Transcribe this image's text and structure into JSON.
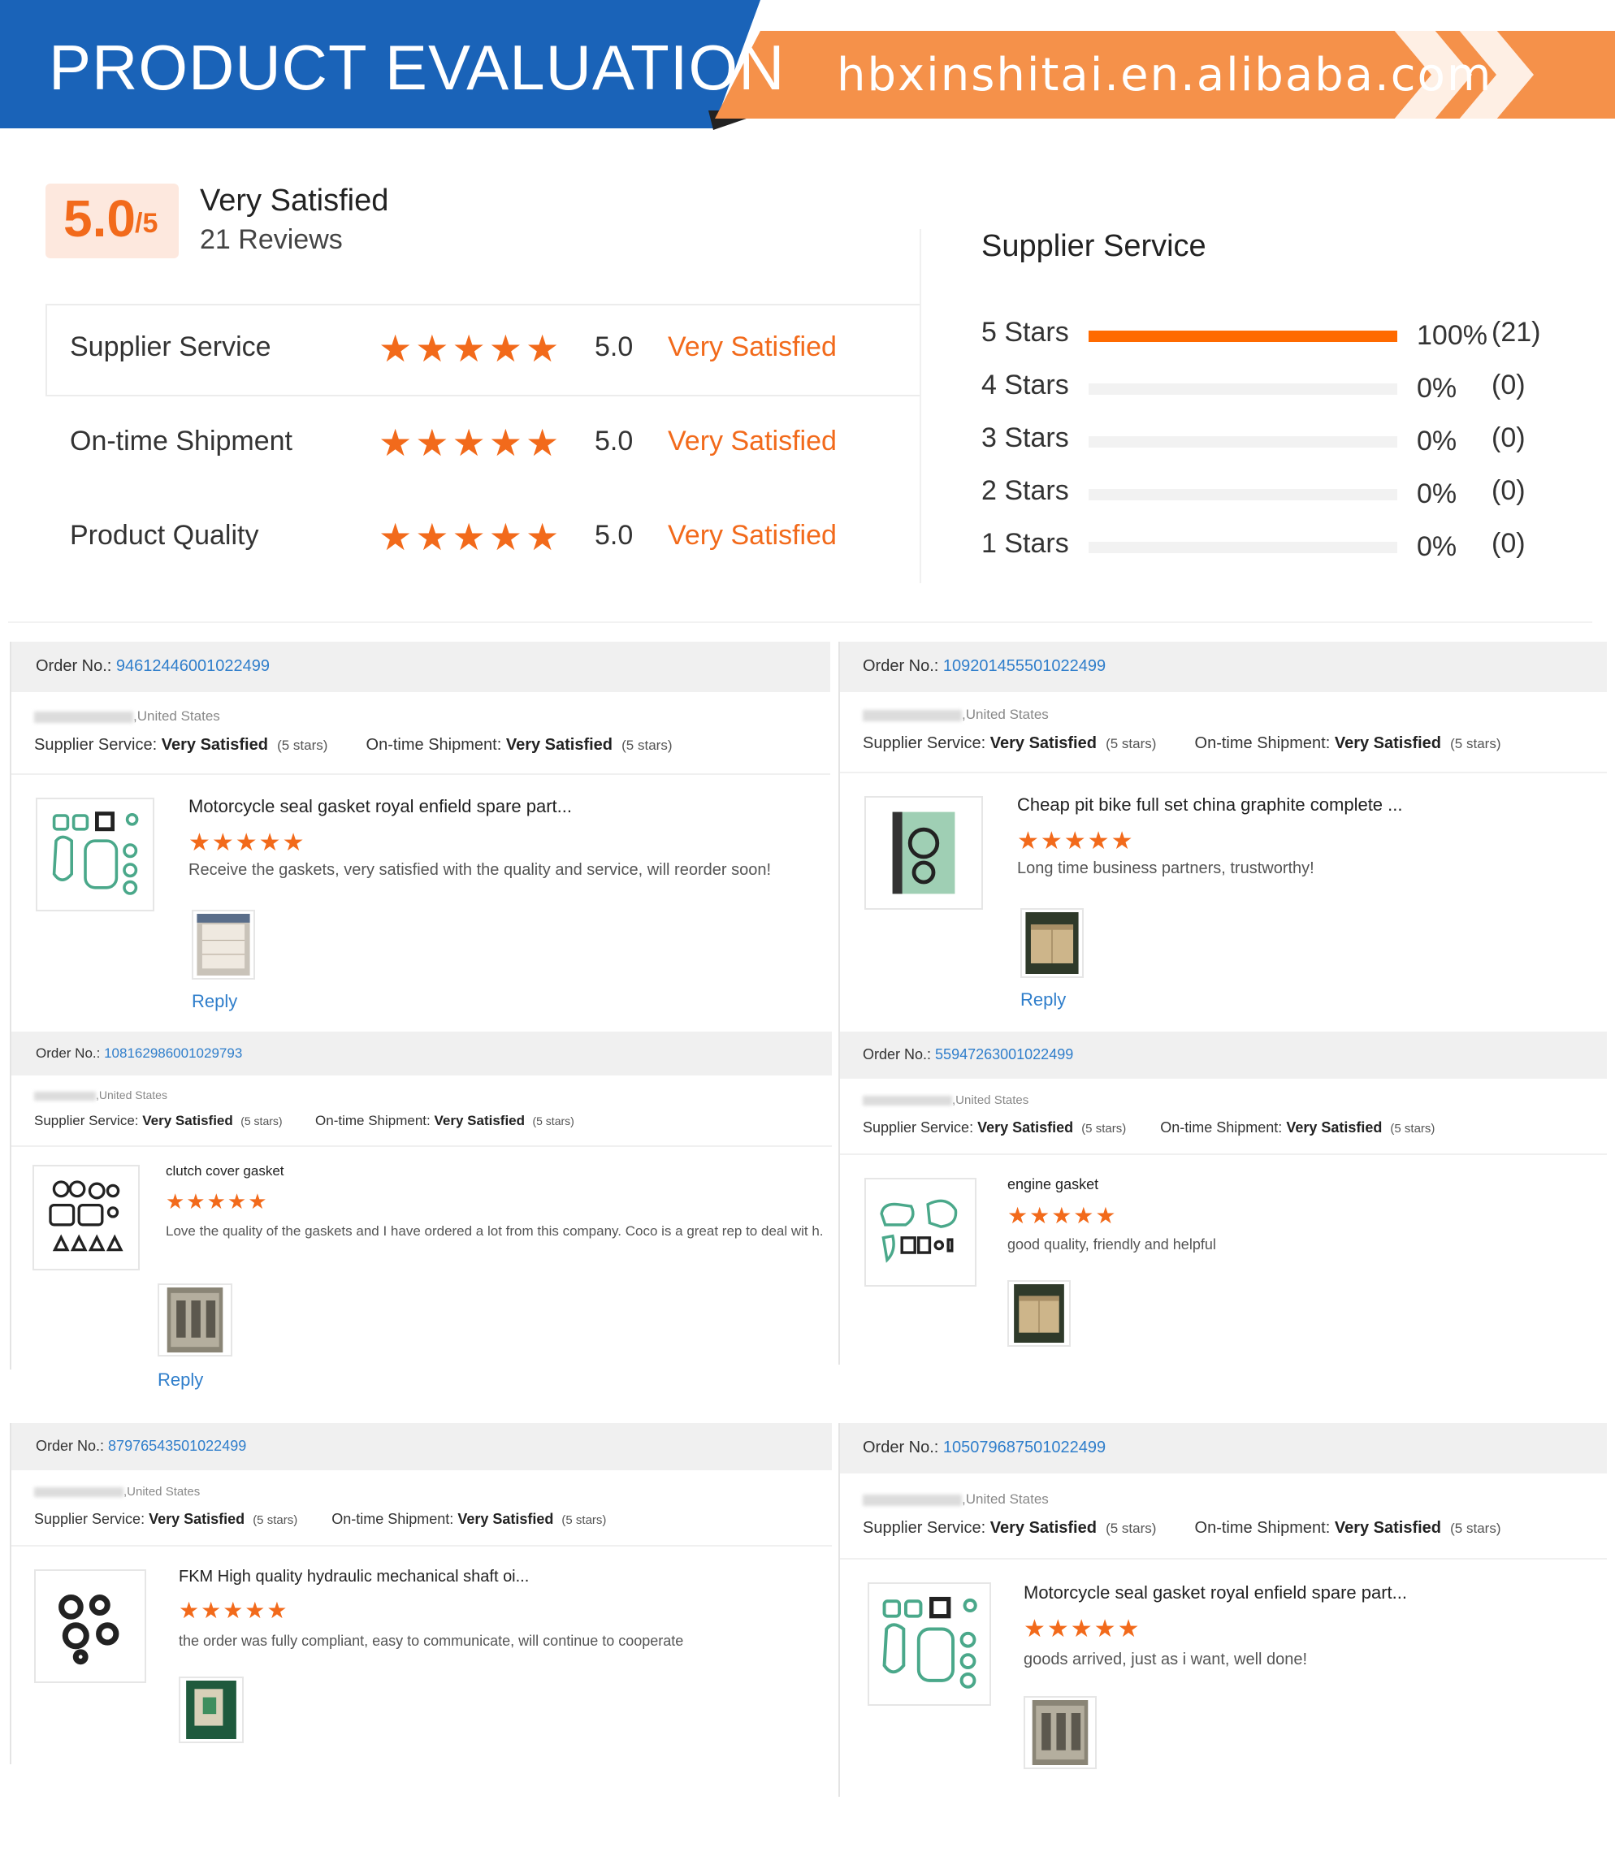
{
  "banner": {
    "title": "PRODUCT EVALUATION",
    "url": "hbxinshitai.en.alibaba.com",
    "colors": {
      "blue": "#1a63b8",
      "orange": "#f5914a"
    }
  },
  "summary": {
    "score": "5.0",
    "score_denominator": "/5",
    "label": "Very Satisfied",
    "reviews": "21 Reviews",
    "rows": [
      {
        "label": "Supplier Service",
        "stars": "★★★★★",
        "score": "5.0",
        "rating": "Very Satisfied"
      },
      {
        "label": "On-time Shipment",
        "stars": "★★★★★",
        "score": "5.0",
        "rating": "Very Satisfied"
      },
      {
        "label": "Product Quality",
        "stars": "★★★★★",
        "score": "5.0",
        "rating": "Very Satisfied"
      }
    ]
  },
  "distribution": {
    "title": "Supplier Service",
    "rows": [
      {
        "label": "5  Stars",
        "fraction": 1.0,
        "pct": "100%",
        "count": "(21)"
      },
      {
        "label": "4  Stars",
        "fraction": 0,
        "pct": "0%",
        "count": "(0)"
      },
      {
        "label": "3  Stars",
        "fraction": 0,
        "pct": "0%",
        "count": "(0)"
      },
      {
        "label": "2  Stars",
        "fraction": 0,
        "pct": "0%",
        "count": "(0)"
      },
      {
        "label": "1  Stars",
        "fraction": 0,
        "pct": "0%",
        "count": "(0)"
      }
    ]
  },
  "reviews": [
    {
      "order_label": "Order No.:",
      "order_no": "94612446001022499",
      "country": ",United States",
      "supplier_label": "Supplier Service:",
      "supplier_val": "Very Satisfied",
      "supplier_stars": "(5 stars)",
      "ship_label": "On-time Shipment:",
      "ship_val": "Very Satisfied",
      "ship_stars": "(5 stars)",
      "product": "Motorcycle seal gasket royal enfield spare part...",
      "stars": "★★★★★",
      "text": "Receive the gaskets, very satisfied with the quality and service, will reorder soon!",
      "reply": "Reply"
    },
    {
      "order_label": "Order No.:",
      "order_no": "109201455501022499",
      "country": ",United States",
      "supplier_label": "Supplier Service:",
      "supplier_val": "Very Satisfied",
      "supplier_stars": "(5 stars)",
      "ship_label": "On-time Shipment:",
      "ship_val": "Very Satisfied",
      "ship_stars": "(5 stars)",
      "product": "Cheap pit bike full set china graphite complete ...",
      "stars": "★★★★★",
      "text": "Long time business partners, trustworthy!",
      "reply": "Reply"
    },
    {
      "order_label": "Order No.:",
      "order_no": "108162986001029793",
      "country": ",United States",
      "supplier_label": "Supplier Service:",
      "supplier_val": "Very Satisfied",
      "supplier_stars": "(5 stars)",
      "ship_label": "On-time Shipment:",
      "ship_val": "Very Satisfied",
      "ship_stars": "(5 stars)",
      "product": "clutch cover gasket",
      "stars": "★★★★★",
      "text": "Love the quality of the gaskets and I have ordered a lot from this company. Coco is a great rep to deal wit h.",
      "reply": "Reply"
    },
    {
      "order_label": "Order No.:",
      "order_no": "55947263001022499",
      "country": ",United States",
      "supplier_label": "Supplier Service:",
      "supplier_val": "Very Satisfied",
      "supplier_stars": "(5 stars)",
      "ship_label": "On-time Shipment:",
      "ship_val": "Very Satisfied",
      "ship_stars": "(5 stars)",
      "product": "engine gasket",
      "stars": "★★★★★",
      "text": "good quality, friendly and helpful",
      "reply": ""
    },
    {
      "order_label": "Order No.:",
      "order_no": "87976543501022499",
      "country": ",United States",
      "supplier_label": "Supplier Service:",
      "supplier_val": "Very Satisfied",
      "supplier_stars": "(5 stars)",
      "ship_label": "On-time Shipment:",
      "ship_val": "Very Satisfied",
      "ship_stars": "(5 stars)",
      "product": "FKM High quality hydraulic mechanical shaft oi...",
      "stars": "★★★★★",
      "text": "the order was fully compliant, easy to communicate, will continue to cooperate",
      "reply": ""
    },
    {
      "order_label": "Order No.:",
      "order_no": "105079687501022499",
      "country": ",United States",
      "supplier_label": "Supplier Service:",
      "supplier_val": "Very Satisfied",
      "supplier_stars": "(5 stars)",
      "ship_label": "On-time Shipment:",
      "ship_val": "Very Satisfied",
      "ship_stars": "(5 stars)",
      "product": "Motorcycle seal gasket royal enfield spare part...",
      "stars": "★★★★★",
      "text": "goods arrived, just as i want, well done!",
      "reply": ""
    }
  ]
}
